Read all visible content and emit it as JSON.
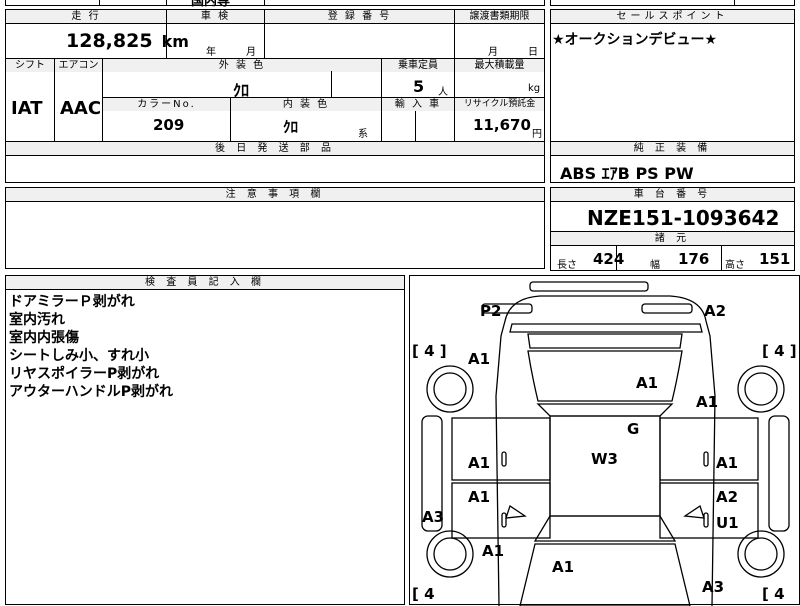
{
  "top_strip": {
    "partial_text": "国内専"
  },
  "row1": {
    "mileage_label": "走 行",
    "mileage_value": "128,825",
    "mileage_unit": "km",
    "inspection_label": "車 検",
    "inspection_year": "年",
    "inspection_month": "月",
    "registration_label": "登 録 番 号",
    "transfer_label": "譲渡書類期限",
    "transfer_month": "月",
    "transfer_day": "日"
  },
  "row2": {
    "shift_label": "シフト",
    "shift_value": "IAT",
    "ac_label": "エアコン",
    "ac_value": "AAC",
    "exterior_label": "外 装 色",
    "exterior_value": "ｸﾛ",
    "capacity_label": "乗車定員",
    "capacity_value": "5",
    "capacity_unit": "人",
    "load_label": "最大積載量",
    "load_unit": "kg",
    "colorno_label": "カラーNo.",
    "colorno_value": "209",
    "interior_label": "内 装 色",
    "interior_value": "ｸﾛ",
    "interior_unit": "系",
    "import_label": "輸 入 車",
    "recycle_label": "リサイクル預託金",
    "recycle_value": "11,670",
    "recycle_unit": "円"
  },
  "later_parts": {
    "label": "後 日 発 送 部 品",
    "value": ""
  },
  "sales_point": {
    "label": "セールスポイント",
    "text": "★オークションデビュー★"
  },
  "equipment": {
    "label": "純 正 装 備",
    "text": "ABS ｴｱB PS PW"
  },
  "caution": {
    "label": "注 意 事 項 欄",
    "text": ""
  },
  "chassis": {
    "label": "車 台 番 号",
    "value": "NZE151-1093642"
  },
  "dimensions": {
    "label": "諸 元",
    "length_label": "長さ",
    "length_value": "424",
    "width_label": "幅",
    "width_value": "176",
    "height_label": "高さ",
    "height_value": "151"
  },
  "inspector": {
    "label": "検 査 員 記 入 欄",
    "notes": [
      "ドアミラーＰ剥がれ",
      "室内汚れ",
      "室内内張傷",
      "シートしみ小、すれ小",
      "リヤスポイラーP剥がれ",
      "アウターハンドルP剥がれ"
    ]
  },
  "diagram": {
    "marks": {
      "p2": "P2",
      "a2_top": "A2",
      "tire_fl": "[ 4 ]",
      "tire_fr": "[ 4 ]",
      "tire_rl": "[ 4",
      "tire_rr": "[ 4",
      "a1_fl": "A1",
      "a1_hood": "A1",
      "a1_fr": "A1",
      "g": "G",
      "w3": "W3",
      "a1_ld1": "A1",
      "a1_rd1": "A1",
      "a1_ld2": "A1",
      "a2_rd2": "A2",
      "u1": "U1",
      "a3_left": "A3",
      "a1_rl": "A1",
      "a1_rear": "A1",
      "a3_rr": "A3"
    }
  }
}
